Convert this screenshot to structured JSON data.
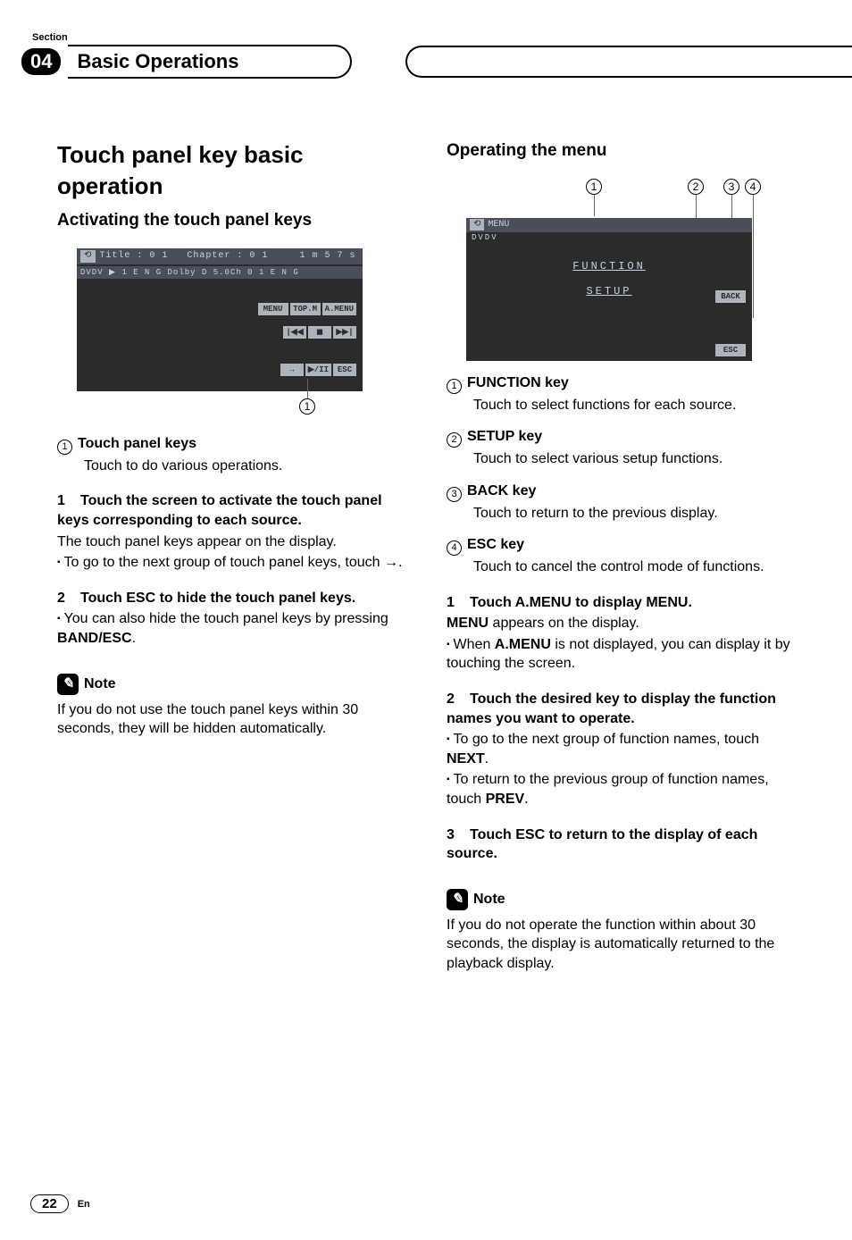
{
  "header": {
    "section_label": "Section",
    "chapter_num": "04",
    "chapter_title": "Basic Operations"
  },
  "left": {
    "h2": "Touch panel key basic operation",
    "h3": "Activating the touch panel keys",
    "screen": {
      "bar_title": "Title : 0 1",
      "bar_chapter": "Chapter : 0 1",
      "bar_time": "1 m 5 7 s",
      "bar2": "DVDV   ▶ 1 E N G   Dolby D 5.0Ch   0 1 E N G",
      "btns": [
        "MENU",
        "TOP.M",
        "A.MENU",
        "|◀◀",
        "◼",
        "▶▶|",
        "→",
        "▶/II",
        "ESC"
      ]
    },
    "callout": {
      "num": "1"
    },
    "def1": {
      "num": "1",
      "title": "Touch panel keys",
      "body": "Touch to do various operations."
    },
    "step1": {
      "n": "1",
      "lead": "Touch the screen to activate the touch panel keys corresponding to each source.",
      "p1": "The touch panel keys appear on the display.",
      "b1": "To go to the next group of touch panel keys, touch ",
      "arrow": "→",
      "b1_end": "."
    },
    "step2": {
      "n": "2",
      "lead": "Touch ESC to hide the touch panel keys.",
      "b1_pre": "You can also hide the touch panel keys by pressing ",
      "b1_bold": "BAND/ESC",
      "b1_post": "."
    },
    "note": {
      "title": "Note",
      "body": "If you do not use the touch panel keys within 30 seconds, they will be hidden automatically."
    }
  },
  "right": {
    "h3": "Operating the menu",
    "screen": {
      "bar": "MENU",
      "dvdv": "DVDV",
      "row1": "FUNCTION",
      "row2": "SETUP",
      "back": "BACK",
      "esc": "ESC"
    },
    "callouts": [
      "1",
      "2",
      "3",
      "4"
    ],
    "defs": [
      {
        "num": "1",
        "title": "FUNCTION key",
        "body": "Touch to select functions for each source."
      },
      {
        "num": "2",
        "title": "SETUP key",
        "body": "Touch to select various setup functions."
      },
      {
        "num": "3",
        "title": "BACK key",
        "body": "Touch to return to the previous display."
      },
      {
        "num": "4",
        "title": "ESC key",
        "body": "Touch to cancel the control mode of functions."
      }
    ],
    "step1": {
      "n": "1",
      "lead": "Touch A.MENU to display MENU.",
      "p1_bold": "MENU",
      "p1_rest": " appears on the display.",
      "b1_pre": "When ",
      "b1_bold": "A.MENU",
      "b1_post": " is not displayed, you can display it by touching the screen."
    },
    "step2": {
      "n": "2",
      "lead": "Touch the desired key to display the function names you want to operate.",
      "b1_pre": "To go to the next group of function names, touch ",
      "b1_bold": "NEXT",
      "b1_post": ".",
      "b2_pre": "To return to the previous group of function names, touch ",
      "b2_bold": "PREV",
      "b2_post": "."
    },
    "step3": {
      "n": "3",
      "lead": "Touch ESC to return to the display of each source."
    },
    "note": {
      "title": "Note",
      "body": "If you do not operate the function within about 30 seconds, the display is automatically returned to the playback display."
    }
  },
  "footer": {
    "page": "22",
    "lang": "En"
  }
}
